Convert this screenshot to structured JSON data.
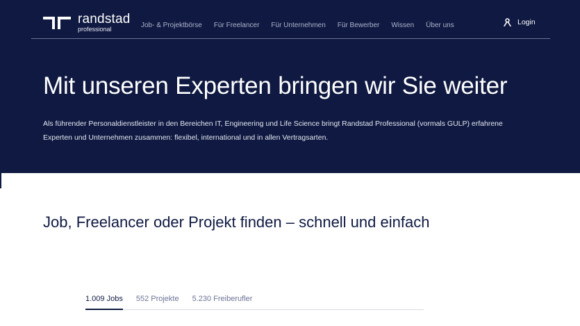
{
  "header": {
    "logo": {
      "name": "randstad",
      "sub": "professional"
    },
    "nav": [
      "Job- & Projektbörse",
      "Für Freelancer",
      "Für Unternehmen",
      "Für Bewerber",
      "Wissen",
      "Über uns"
    ],
    "login_label": "Login"
  },
  "hero": {
    "title": "Mit unseren Experten bringen wir Sie weiter",
    "text": "Als führender Personaldienstleister in den Bereichen IT, Engineering und Life Science bringt Randstad Professional (vormals GULP) erfahrene Experten und Unternehmen zusammen: flexibel, international und in allen Vertragsarten."
  },
  "search_section": {
    "title": "Job, Freelancer oder Projekt finden – schnell und einfach",
    "tabs": [
      {
        "label": "1.009 Jobs",
        "active": true
      },
      {
        "label": "552 Projekte",
        "active": false
      },
      {
        "label": "5.230 Freiberufler",
        "active": false
      }
    ]
  },
  "colors": {
    "brand_navy": "#0f1941",
    "nav_muted": "#aeb4cc"
  },
  "icons": {
    "logo": "randstad-logo-icon",
    "login": "user-icon"
  }
}
